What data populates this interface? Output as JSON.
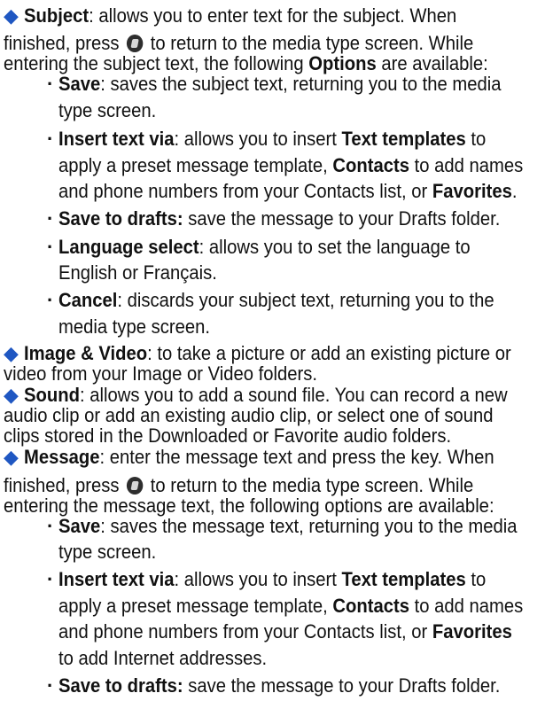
{
  "subject": {
    "title": "Subject",
    "line1_rest": ": allows you to enter text for the subject. When",
    "line2_a": "finished, press",
    "line2_b": "to return to the media type screen. While",
    "line3_a": "entering the subject text, the following",
    "line3_bold": "Options",
    "line3_b": "are available:",
    "options": {
      "save_title": "Save",
      "save_1": ": saves the subject text, returning you to the media",
      "save_2": "type screen.",
      "insert_title": "Insert text via",
      "insert_1": ": allows you to insert",
      "insert_tt": "Text templates",
      "insert_1b": "to",
      "insert_2a": "apply a preset message template,",
      "insert_contacts": "Contacts",
      "insert_2b": "to add names",
      "insert_3a": "and phone numbers from your Contacts list, or",
      "insert_fav": "Favorites",
      "insert_3b": ".",
      "drafts_title": "Save to drafts:",
      "drafts_rest": "save the message to your Drafts folder.",
      "lang_title": "Language select",
      "lang_1": ": allows you to set the language to",
      "lang_2": "English or Français.",
      "cancel_title": "Cancel",
      "cancel_1": ": discards your subject text, returning you to the",
      "cancel_2": "media type screen."
    }
  },
  "image": {
    "title": "Image & Video",
    "line1_rest": ": to take a picture or add an existing picture or",
    "line2": "video from your Image or Video folders."
  },
  "sound": {
    "title": "Sound",
    "line1_rest": ": allows you to add a sound file. You can record a new",
    "line2": "audio clip or add an existing audio clip, or select one of sound",
    "line3": "clips stored in the Downloaded or Favorite audio folders."
  },
  "message": {
    "title": "Message",
    "line1_rest": ": enter the message text and press the key. When",
    "line2_a": "finished, press",
    "line2_b": "to return to the media type screen. While",
    "line3": "entering the message text, the following options are available:",
    "options": {
      "save_title": "Save",
      "save_1": ": saves the message text, returning you to the media",
      "save_2": "type screen.",
      "insert_title": "Insert text via",
      "insert_1": ": allows you to insert",
      "insert_tt": "Text templates",
      "insert_1b": "to",
      "insert_2a": "apply a preset message template,",
      "insert_contacts": "Contacts",
      "insert_2b": "to add names",
      "insert_3a": "and phone numbers from your Contacts list, or",
      "insert_fav": "Favorites",
      "insert_4": "to add Internet addresses.",
      "drafts_title": "Save to drafts:",
      "drafts_rest": "save the message to your Drafts folder."
    }
  },
  "icons": {
    "bullet_color": "#1f57c2",
    "key_icon": "softkey-icon"
  }
}
